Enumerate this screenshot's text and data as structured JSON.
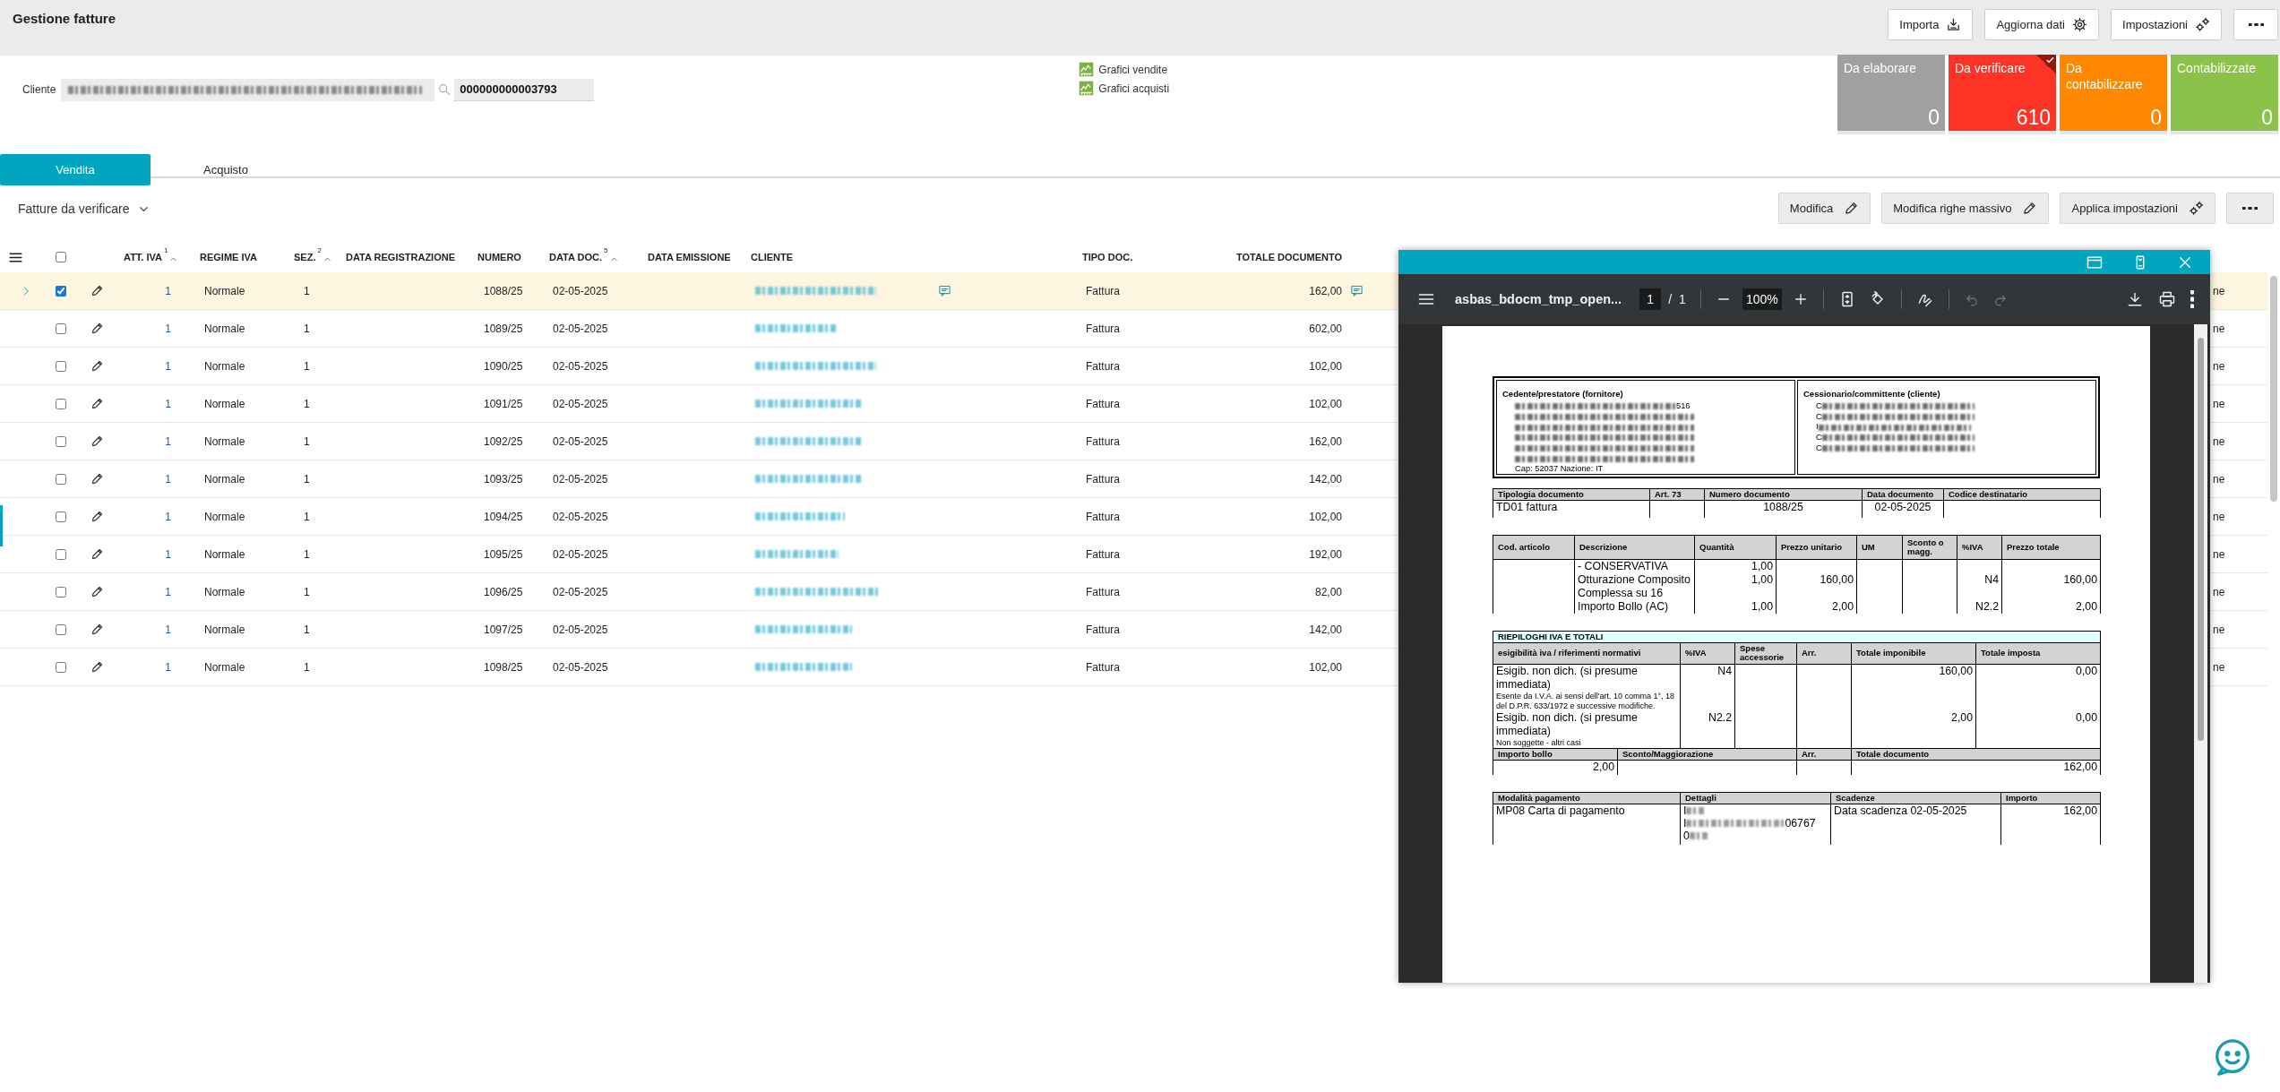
{
  "header": {
    "title": "Gestione fatture",
    "buttons": [
      {
        "kind": "button",
        "label": "Importa"
      },
      {
        "kind": "button",
        "label": "Aggiorna dati"
      },
      {
        "kind": "button",
        "label": "Impostazioni"
      },
      {
        "kind": "menu"
      }
    ]
  },
  "client": {
    "label": "Cliente",
    "name_blurred": true,
    "code": "000000000003793"
  },
  "chart_links": [
    "Grafici vendite",
    "Grafici acquisti"
  ],
  "status_tiles": [
    {
      "label": "Da elaborare",
      "count": "0",
      "color": "#a0a0a0",
      "selected": false
    },
    {
      "label": "Da verificare",
      "count": "610",
      "color": "#ff3326",
      "selected": true
    },
    {
      "label": "Da contabilizzare",
      "count": "0",
      "color": "#ff8800",
      "selected": false
    },
    {
      "label": "Contabilizzate",
      "count": "0",
      "color": "#8bc34a",
      "selected": false
    }
  ],
  "tabs": [
    {
      "label": "Vendita",
      "selected": true
    },
    {
      "label": "Acquisto",
      "selected": false
    }
  ],
  "filter": {
    "label": "Fatture da verificare"
  },
  "actions": [
    {
      "kind": "button",
      "label": "Modifica"
    },
    {
      "kind": "button",
      "label": "Modifica righe massivo"
    },
    {
      "kind": "button",
      "label": "Applica impostazioni"
    },
    {
      "kind": "menu"
    }
  ],
  "table": {
    "all_checked": false,
    "columns": [
      {
        "label": "ATT. IVA",
        "sort": "1"
      },
      {
        "label": "REGIME IVA"
      },
      {
        "label": "SEZ.",
        "sort": "2"
      },
      {
        "label": "DATA REGISTRAZIONE"
      },
      {
        "label": "NUMERO"
      },
      {
        "label": "DATA DOC.",
        "sort": "5"
      },
      {
        "label": "DATA EMISSIONE"
      },
      {
        "label": "CLIENTE"
      },
      {
        "label": "TIPO DOC."
      },
      {
        "label": "TOTALE DOCUMENTO"
      }
    ],
    "rows": [
      {
        "selected": true,
        "checked": true,
        "att_iva": "1",
        "regime_iva": "Normale",
        "sez": "1",
        "numero": "1088/25",
        "data_doc": "02-05-2025",
        "client_blurred": true,
        "client_note": true,
        "tipo_doc": "Fattura",
        "totale": "162,00",
        "total_note": true,
        "column_11": "ne"
      },
      {
        "selected": false,
        "checked": false,
        "att_iva": "1",
        "regime_iva": "Normale",
        "sez": "1",
        "numero": "1089/25",
        "data_doc": "02-05-2025",
        "client_blurred": true,
        "client_note": false,
        "tipo_doc": "Fattura",
        "totale": "602,00",
        "total_note": false,
        "column_11": "ne"
      },
      {
        "selected": false,
        "checked": false,
        "att_iva": "1",
        "regime_iva": "Normale",
        "sez": "1",
        "numero": "1090/25",
        "data_doc": "02-05-2025",
        "client_blurred": true,
        "client_note": false,
        "tipo_doc": "Fattura",
        "totale": "102,00",
        "total_note": false,
        "column_11": "ne"
      },
      {
        "selected": false,
        "checked": false,
        "att_iva": "1",
        "regime_iva": "Normale",
        "sez": "1",
        "numero": "1091/25",
        "data_doc": "02-05-2025",
        "client_blurred": true,
        "client_note": false,
        "tipo_doc": "Fattura",
        "totale": "102,00",
        "total_note": false,
        "column_11": "ne"
      },
      {
        "selected": false,
        "checked": false,
        "att_iva": "1",
        "regime_iva": "Normale",
        "sez": "1",
        "numero": "1092/25",
        "data_doc": "02-05-2025",
        "client_blurred": true,
        "client_note": false,
        "tipo_doc": "Fattura",
        "totale": "162,00",
        "total_note": false,
        "column_11": "ne"
      },
      {
        "selected": false,
        "checked": false,
        "att_iva": "1",
        "regime_iva": "Normale",
        "sez": "1",
        "numero": "1093/25",
        "data_doc": "02-05-2025",
        "client_blurred": true,
        "client_note": false,
        "tipo_doc": "Fattura",
        "totale": "142,00",
        "total_note": false,
        "column_11": "ne"
      },
      {
        "selected": false,
        "checked": false,
        "att_iva": "1",
        "regime_iva": "Normale",
        "sez": "1",
        "numero": "1094/25",
        "data_doc": "02-05-2025",
        "client_blurred": true,
        "client_note": false,
        "tipo_doc": "Fattura",
        "totale": "102,00",
        "total_note": false,
        "column_11": "ne"
      },
      {
        "selected": false,
        "checked": false,
        "att_iva": "1",
        "regime_iva": "Normale",
        "sez": "1",
        "numero": "1095/25",
        "data_doc": "02-05-2025",
        "client_blurred": true,
        "client_note": false,
        "tipo_doc": "Fattura",
        "totale": "192,00",
        "total_note": false,
        "column_11": "ne"
      },
      {
        "selected": false,
        "checked": false,
        "att_iva": "1",
        "regime_iva": "Normale",
        "sez": "1",
        "numero": "1096/25",
        "data_doc": "02-05-2025",
        "client_blurred": true,
        "client_note": false,
        "tipo_doc": "Fattura",
        "totale": "82,00",
        "total_note": false,
        "column_11": "ne"
      },
      {
        "selected": false,
        "checked": false,
        "att_iva": "1",
        "regime_iva": "Normale",
        "sez": "1",
        "numero": "1097/25",
        "data_doc": "02-05-2025",
        "client_blurred": true,
        "client_note": false,
        "tipo_doc": "Fattura",
        "totale": "142,00",
        "total_note": false,
        "column_11": "ne"
      },
      {
        "selected": false,
        "checked": false,
        "att_iva": "1",
        "regime_iva": "Normale",
        "sez": "1",
        "numero": "1098/25",
        "data_doc": "02-05-2025",
        "client_blurred": true,
        "client_note": false,
        "tipo_doc": "Fattura",
        "totale": "102,00",
        "total_note": false,
        "column_11": "ne"
      }
    ]
  },
  "pdf_viewer": {
    "filename": "asbas_bdocm_tmp_open...",
    "page": "1",
    "page_separator": "/",
    "pages": "1",
    "zoom": "100%",
    "document": {
      "supplier": {
        "heading": "Cedente/prestatore (fornitore)",
        "lines": [
          {
            "blurred": true,
            "suffix": "516"
          },
          {
            "blurred": true
          },
          {
            "blurred": true
          },
          {
            "blurred": true
          },
          {
            "blurred": true
          },
          {
            "blurred": true
          },
          {
            "blurred": false,
            "prefix": "Cap: 52037 Nazione: IT"
          }
        ]
      },
      "customer": {
        "heading": "Cessionario/committente (cliente)",
        "lines": [
          {
            "blurred": true,
            "prefix": "C"
          },
          {
            "blurred": true,
            "prefix": "C"
          },
          {
            "blurred": true,
            "prefix": "I"
          },
          {
            "blurred": true,
            "prefix": "C"
          },
          {
            "blurred": true,
            "prefix": "C"
          }
        ]
      },
      "doc_info": [
        {
          "header": "Tipologia documento",
          "value": "TD01 fattura"
        },
        {
          "header": "Art. 73"
        },
        {
          "header": "Numero documento",
          "value": "1088/25"
        },
        {
          "header": "Data documento",
          "value": "02-05-2025"
        },
        {
          "header": "Codice destinatario"
        }
      ],
      "lines": {
        "headers": [
          "Cod. articolo",
          "Descrizione",
          "Quantità",
          "Prezzo unitario",
          "UM",
          "Sconto o magg.",
          "%IVA",
          "Prezzo totale"
        ],
        "rows": [
          {
            "description": "- CONSERVATIVA",
            "quantity": "1,00"
          },
          {
            "description": "Otturazione Composito Complessa su 16",
            "quantity": "1,00",
            "unit_price": "160,00",
            "vat": "N4",
            "total": "160,00"
          },
          {
            "description": "Importo Bollo (AC)",
            "quantity": "1,00",
            "unit_price": "2,00",
            "vat": "N2.2",
            "total": "2,00"
          }
        ]
      },
      "vat_summary": {
        "title": "RIEPILOGHI IVA E TOTALI",
        "headers": [
          "esigibilità iva / riferimenti normativi",
          "%IVA",
          "Spese accessorie",
          "Arr.",
          "Totale imponibile",
          "Totale imposta"
        ],
        "rows": [
          {
            "description": "Esigib. non dich. (si presume immediata)",
            "note": "Esente da I.V.A. ai sensi dell'art. 10 comma 1°, 18 del D.P.R. 633/1972 e successive modifiche.",
            "vat": "N4",
            "taxable": "160,00",
            "tax": "0,00"
          },
          {
            "description": "Esigib. non dich. (si presume immediata)",
            "note": "Non soggette - altri casi",
            "vat": "N2.2",
            "taxable": "2,00",
            "tax": "0,00"
          }
        ],
        "totals_headers": [
          "Importo bollo",
          "Sconto/Maggiorazione",
          "Arr.",
          "Totale documento"
        ],
        "stamp_duty": "2,00",
        "document_total": "162,00"
      },
      "payment": {
        "headers": [
          "Modalità pagamento",
          "Dettagli",
          "Scadenze",
          "Importo"
        ],
        "method": "MP08 Carta di pagamento",
        "details": [
          {
            "blurred": true,
            "prefix": "I"
          },
          {
            "blurred": true,
            "prefix": "I",
            "suffix": "06767"
          },
          {
            "blurred": true,
            "prefix": "0"
          }
        ],
        "due": "Data scadenza 02-05-2025",
        "amount": "162,00"
      }
    }
  }
}
